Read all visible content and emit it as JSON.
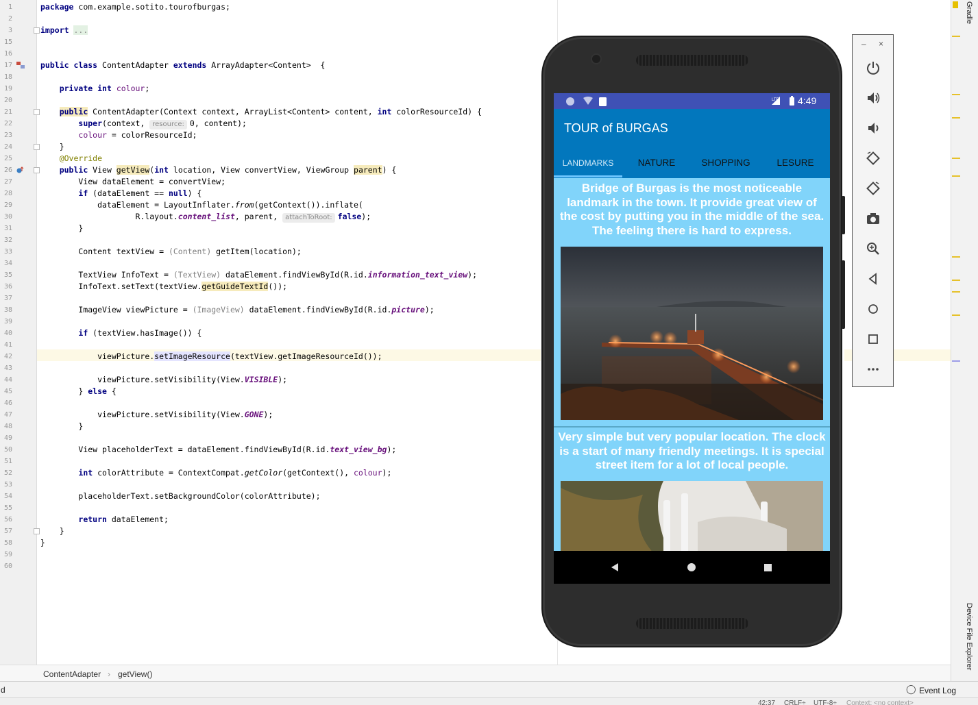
{
  "editor": {
    "code_lines": [
      {
        "n": "1",
        "segs": [
          {
            "c": "kw",
            "t": "package"
          },
          {
            "t": " com.example.sotito.tourofburgas;"
          }
        ]
      },
      {
        "n": "2",
        "segs": []
      },
      {
        "n": "3",
        "segs": [
          {
            "c": "kw",
            "t": "import"
          },
          {
            "t": " "
          },
          {
            "c": "import-dots",
            "t": "..."
          }
        ]
      },
      {
        "n": "15",
        "segs": []
      },
      {
        "n": "16",
        "segs": []
      },
      {
        "n": "17",
        "segs": [
          {
            "c": "kw",
            "t": "public class"
          },
          {
            "t": " ContentAdapter "
          },
          {
            "c": "kw",
            "t": "extends"
          },
          {
            "t": " ArrayAdapter<Content>  {"
          }
        ]
      },
      {
        "n": "18",
        "segs": []
      },
      {
        "n": "19",
        "segs": [
          {
            "t": "    "
          },
          {
            "c": "kw",
            "t": "private int"
          },
          {
            "t": " "
          },
          {
            "c": "fld2",
            "t": "colour"
          },
          {
            "t": ";"
          }
        ]
      },
      {
        "n": "20",
        "segs": []
      },
      {
        "n": "21",
        "segs": [
          {
            "t": "    "
          },
          {
            "c": "kw hl-yel",
            "t": "public"
          },
          {
            "t": " ContentAdapter(Context context, ArrayList<Content> content, "
          },
          {
            "c": "kw",
            "t": "int"
          },
          {
            "t": " colorResourceId) {"
          }
        ]
      },
      {
        "n": "22",
        "segs": [
          {
            "t": "        "
          },
          {
            "c": "kw",
            "t": "super"
          },
          {
            "t": "(context, "
          },
          {
            "c": "hint",
            "t": "resource:"
          },
          {
            "t": "0, content);"
          }
        ]
      },
      {
        "n": "23",
        "segs": [
          {
            "t": "        "
          },
          {
            "c": "fld2",
            "t": "colour"
          },
          {
            "t": " = colorResourceId;"
          }
        ]
      },
      {
        "n": "24",
        "segs": [
          {
            "t": "    }"
          }
        ]
      },
      {
        "n": "25",
        "segs": [
          {
            "t": "    "
          },
          {
            "c": "ann",
            "t": "@Override"
          }
        ]
      },
      {
        "n": "26",
        "segs": [
          {
            "t": "    "
          },
          {
            "c": "kw",
            "t": "public"
          },
          {
            "t": " View "
          },
          {
            "c": "hl-yel",
            "t": "getView"
          },
          {
            "t": "("
          },
          {
            "c": "kw",
            "t": "int"
          },
          {
            "t": " location, View convertView, ViewGroup "
          },
          {
            "c": "hl-yel",
            "t": "parent"
          },
          {
            "t": ") {"
          }
        ]
      },
      {
        "n": "27",
        "segs": [
          {
            "t": "        View dataElement = convertView;"
          }
        ]
      },
      {
        "n": "28",
        "segs": [
          {
            "t": "        "
          },
          {
            "c": "kw",
            "t": "if"
          },
          {
            "t": " (dataElement == "
          },
          {
            "c": "kw",
            "t": "null"
          },
          {
            "t": ") {"
          }
        ]
      },
      {
        "n": "29",
        "segs": [
          {
            "t": "            dataElement = LayoutInflater."
          },
          {
            "c": "st",
            "t": "from"
          },
          {
            "t": "(getContext()).inflate("
          }
        ]
      },
      {
        "n": "30",
        "segs": [
          {
            "t": "                    R.layout."
          },
          {
            "c": "fld",
            "t": "content_list"
          },
          {
            "t": ", parent, "
          },
          {
            "c": "hint",
            "t": "attachToRoot:"
          },
          {
            "c": "kw",
            "t": "false"
          },
          {
            "t": ");"
          }
        ]
      },
      {
        "n": "31",
        "segs": [
          {
            "t": "        }"
          }
        ]
      },
      {
        "n": "32",
        "segs": []
      },
      {
        "n": "33",
        "segs": [
          {
            "t": "        Content textView = "
          },
          {
            "c": "cast",
            "t": "(Content)"
          },
          {
            "t": " getItem(location);"
          }
        ]
      },
      {
        "n": "34",
        "segs": []
      },
      {
        "n": "35",
        "segs": [
          {
            "t": "        TextView InfoText = "
          },
          {
            "c": "cast",
            "t": "(TextView)"
          },
          {
            "t": " dataElement.findViewById(R.id."
          },
          {
            "c": "fld",
            "t": "information_text_view"
          },
          {
            "t": ");"
          }
        ]
      },
      {
        "n": "36",
        "segs": [
          {
            "t": "        InfoText.setText(textView."
          },
          {
            "c": "hl-yel",
            "t": "getGuideTextId"
          },
          {
            "t": "());"
          }
        ]
      },
      {
        "n": "37",
        "segs": []
      },
      {
        "n": "38",
        "segs": [
          {
            "t": "        ImageView viewPicture = "
          },
          {
            "c": "cast",
            "t": "(ImageView)"
          },
          {
            "t": " dataElement.findViewById(R.id."
          },
          {
            "c": "fld",
            "t": "picture"
          },
          {
            "t": ");"
          }
        ]
      },
      {
        "n": "39",
        "segs": []
      },
      {
        "n": "40",
        "segs": [
          {
            "t": "        "
          },
          {
            "c": "kw",
            "t": "if"
          },
          {
            "t": " (textView.hasImage()) {"
          }
        ]
      },
      {
        "n": "41",
        "segs": []
      },
      {
        "n": "42",
        "segs": [
          {
            "t": "            viewPicture."
          },
          {
            "c": "hl-blue",
            "t": "setImageResource"
          },
          {
            "t": "(textView.getImageResourceId());"
          }
        ]
      },
      {
        "n": "43",
        "segs": []
      },
      {
        "n": "44",
        "segs": [
          {
            "t": "            viewPicture.setVisibility(View."
          },
          {
            "c": "fld",
            "t": "VISIBLE"
          },
          {
            "t": ");"
          }
        ]
      },
      {
        "n": "45",
        "segs": [
          {
            "t": "        } "
          },
          {
            "c": "kw",
            "t": "else"
          },
          {
            "t": " {"
          }
        ]
      },
      {
        "n": "46",
        "segs": []
      },
      {
        "n": "47",
        "segs": [
          {
            "t": "            viewPicture.setVisibility(View."
          },
          {
            "c": "fld",
            "t": "GONE"
          },
          {
            "t": ");"
          }
        ]
      },
      {
        "n": "48",
        "segs": [
          {
            "t": "        }"
          }
        ]
      },
      {
        "n": "49",
        "segs": []
      },
      {
        "n": "50",
        "segs": [
          {
            "t": "        View placeholderText = dataElement.findViewById(R.id."
          },
          {
            "c": "fld",
            "t": "text_view_bg"
          },
          {
            "t": ");"
          }
        ]
      },
      {
        "n": "51",
        "segs": []
      },
      {
        "n": "52",
        "segs": [
          {
            "t": "        "
          },
          {
            "c": "kw",
            "t": "int"
          },
          {
            "t": " colorAttribute = ContextCompat."
          },
          {
            "c": "st",
            "t": "getColor"
          },
          {
            "t": "(getContext(), "
          },
          {
            "c": "fld2",
            "t": "colour"
          },
          {
            "t": ");"
          }
        ]
      },
      {
        "n": "53",
        "segs": []
      },
      {
        "n": "54",
        "segs": [
          {
            "t": "        placeholderText.setBackgroundColor(colorAttribute);"
          }
        ]
      },
      {
        "n": "55",
        "segs": []
      },
      {
        "n": "56",
        "segs": [
          {
            "t": "        "
          },
          {
            "c": "kw",
            "t": "return"
          },
          {
            "t": " dataElement;"
          }
        ]
      },
      {
        "n": "57",
        "segs": [
          {
            "t": "    }"
          }
        ]
      },
      {
        "n": "58",
        "segs": [
          {
            "t": "}"
          }
        ]
      },
      {
        "n": "59",
        "segs": []
      },
      {
        "n": "60",
        "segs": []
      }
    ]
  },
  "breadcrumb": {
    "class_name": "ContentAdapter",
    "separator": "›",
    "method_name": "getView()"
  },
  "bottom_bar": {
    "left_text": "d",
    "event_log": "Event Log"
  },
  "status_bar": {
    "position": "42:37",
    "line_sep": "CRLF÷",
    "encoding": "UTF-8÷",
    "context": "Context: <no context>"
  },
  "right_strip": {
    "gradle": "Gradle",
    "device_file_explorer": "Device File Explorer"
  },
  "emulator": {
    "window_minimize": "–",
    "window_close": "×",
    "buttons": [
      {
        "name": "power-icon",
        "glyph": "⏻"
      },
      {
        "name": "volume-up-icon",
        "glyph": "🔊"
      },
      {
        "name": "volume-down-icon",
        "glyph": "🔉"
      },
      {
        "name": "rotate-left-icon",
        "glyph": "⟲"
      },
      {
        "name": "rotate-right-icon",
        "glyph": "⟳"
      },
      {
        "name": "camera-icon",
        "glyph": "📷"
      },
      {
        "name": "zoom-icon",
        "glyph": "🔍"
      },
      {
        "name": "back-icon",
        "glyph": "◁"
      },
      {
        "name": "home-icon",
        "glyph": "○"
      },
      {
        "name": "overview-icon",
        "glyph": "□"
      },
      {
        "name": "more-icon",
        "glyph": "•••"
      }
    ]
  },
  "phone": {
    "time": "4:49",
    "app_title": "TOUR of BURGAS",
    "tabs": [
      "LANDMARKS",
      "NATURE",
      "SHOPPING",
      "LESURE"
    ],
    "selected_tab": "LANDMARKS",
    "items": [
      {
        "text": "Bridge of Burgas is the most noticeable landmark in the town. It provide great view of the cost by putting you in the middle of the sea. The feeling there is hard to express."
      },
      {
        "text": "Very simple but very popular location. The clock is a start of many friendly meetings. It is special street item for a lot of local people."
      }
    ],
    "colors": {
      "status": "#3f51b5",
      "toolbar": "#0277bd",
      "content_bg": "#81d4fa"
    }
  }
}
